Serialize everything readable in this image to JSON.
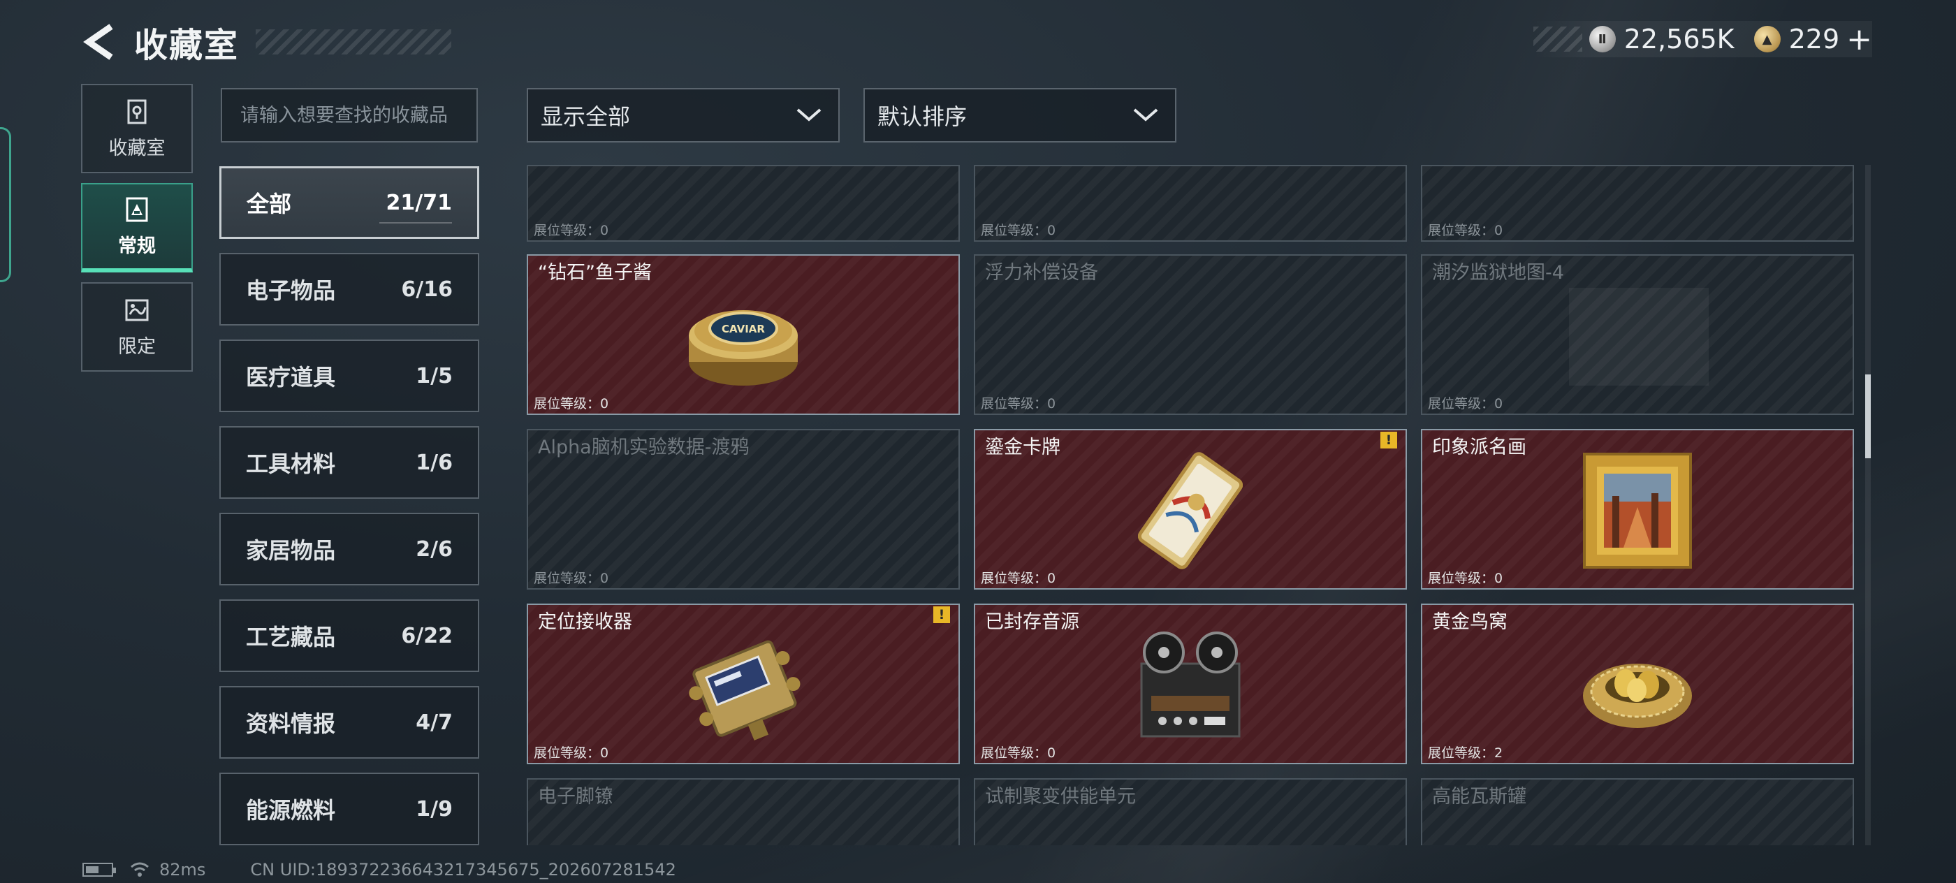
{
  "header": {
    "title": "收藏室",
    "silver_amount": "22,565K",
    "gold_amount": "229",
    "plus_label": "+"
  },
  "rail": [
    {
      "label": "收藏室",
      "icon": "vault-icon",
      "active": false
    },
    {
      "label": "常规",
      "icon": "regular-collection-icon",
      "active": true
    },
    {
      "label": "限定",
      "icon": "limited-collection-icon",
      "active": false
    }
  ],
  "search": {
    "placeholder": "请输入想要查找的收藏品"
  },
  "categories": [
    {
      "label": "全部",
      "count": "21/71",
      "active": true
    },
    {
      "label": "电子物品",
      "count": "6/16"
    },
    {
      "label": "医疗道具",
      "count": "1/5"
    },
    {
      "label": "工具材料",
      "count": "1/6"
    },
    {
      "label": "家居物品",
      "count": "2/6"
    },
    {
      "label": "工艺藏品",
      "count": "6/22"
    },
    {
      "label": "资料情报",
      "count": "4/7"
    },
    {
      "label": "能源燃料",
      "count": "1/9"
    }
  ],
  "filters": {
    "display": "显示全部",
    "sort": "默认排序"
  },
  "level_prefix": "展位等级：",
  "items": [
    {
      "name": "",
      "level": "0",
      "owned": false,
      "warn": false
    },
    {
      "name": "",
      "level": "0",
      "owned": false,
      "warn": false
    },
    {
      "name": "",
      "level": "0",
      "owned": false,
      "warn": false
    },
    {
      "name": "“钻石”鱼子酱",
      "level": "0",
      "owned": true,
      "warn": false,
      "icon": "caviar-tin-icon"
    },
    {
      "name": "浮力补偿设备",
      "level": "0",
      "owned": false,
      "warn": false
    },
    {
      "name": "潮汐监狱地图-4",
      "level": "0",
      "owned": false,
      "warn": false
    },
    {
      "name": "Alpha脑机实验数据-渡鸦",
      "level": "0",
      "owned": false,
      "warn": false
    },
    {
      "name": "鎏金卡牌",
      "level": "0",
      "owned": true,
      "warn": true,
      "icon": "gilded-card-icon"
    },
    {
      "name": "印象派名画",
      "level": "0",
      "owned": true,
      "warn": false,
      "icon": "framed-painting-icon"
    },
    {
      "name": "定位接收器",
      "level": "0",
      "owned": true,
      "warn": true,
      "icon": "locator-receiver-icon"
    },
    {
      "name": "已封存音源",
      "level": "0",
      "owned": true,
      "warn": false,
      "icon": "reel-to-reel-recorder-icon"
    },
    {
      "name": "黄金鸟窝",
      "level": "2",
      "owned": true,
      "warn": false,
      "icon": "golden-nest-icon"
    },
    {
      "name": "电子脚镣",
      "level": "",
      "owned": false,
      "warn": false
    },
    {
      "name": "试制聚变供能单元",
      "level": "",
      "owned": false,
      "warn": false
    },
    {
      "name": "高能瓦斯罐",
      "level": "",
      "owned": false,
      "warn": false
    }
  ],
  "caviar_label": "CAVIAR",
  "warn_symbol": "!",
  "status": {
    "ping": "82ms",
    "uid": "CN UID:189372236643217345675_202607281542"
  }
}
